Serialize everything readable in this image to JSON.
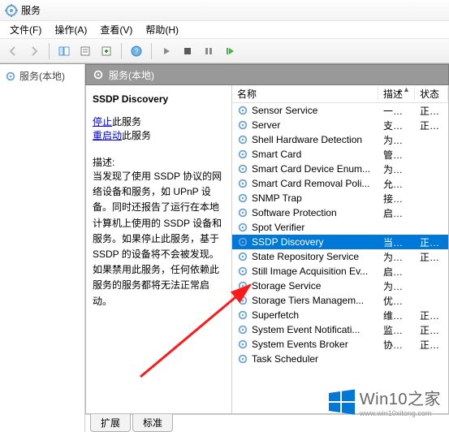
{
  "title": "服务",
  "menus": {
    "file": "文件(F)",
    "action": "操作(A)",
    "view": "查看(V)",
    "help": "帮助(H)"
  },
  "tree": {
    "root": "服务(本地)"
  },
  "panel_header": "服务(本地)",
  "detail": {
    "name_heading": "SSDP Discovery",
    "stop_link": "停止",
    "stop_suffix": "此服务",
    "restart_link": "重启动",
    "restart_suffix": "此服务",
    "desc_label": "描述:",
    "desc_text": "当发现了使用 SSDP 协议的网络设备和服务，如 UPnP 设备。同时还报告了运行在本地计算机上使用的 SSDP 设备和服务。如果停止此服务，基于 SSDP 的设备将不会被发现。如果禁用此服务，任何依赖此服务的服务都将无法正常启动。"
  },
  "columns": {
    "name": "名称",
    "desc": "描述",
    "status": "状态"
  },
  "services": [
    {
      "name": "Sensor Service",
      "desc": "一项...",
      "status": "正在..."
    },
    {
      "name": "Server",
      "desc": "支持...",
      "status": "正在..."
    },
    {
      "name": "Shell Hardware Detection",
      "desc": "为自...",
      "status": ""
    },
    {
      "name": "Smart Card",
      "desc": "管理...",
      "status": ""
    },
    {
      "name": "Smart Card Device Enum...",
      "desc": "为给...",
      "status": ""
    },
    {
      "name": "Smart Card Removal Poli...",
      "desc": "允许...",
      "status": ""
    },
    {
      "name": "SNMP Trap",
      "desc": "接收...",
      "status": ""
    },
    {
      "name": "Software Protection",
      "desc": "启用...",
      "status": ""
    },
    {
      "name": "Spot Verifier",
      "desc": "",
      "status": ""
    },
    {
      "name": "SSDP Discovery",
      "desc": "当发...",
      "status": "正在...",
      "selected": true
    },
    {
      "name": "State Repository Service",
      "desc": "为应...",
      "status": "正在..."
    },
    {
      "name": "Still Image Acquisition Ev...",
      "desc": "启动...",
      "status": ""
    },
    {
      "name": "Storage Service",
      "desc": "为存...",
      "status": ""
    },
    {
      "name": "Storage Tiers Managem...",
      "desc": "优化...",
      "status": ""
    },
    {
      "name": "Superfetch",
      "desc": "维护...",
      "status": "正在..."
    },
    {
      "name": "System Event Notificati...",
      "desc": "监视...",
      "status": "正在..."
    },
    {
      "name": "System Events Broker",
      "desc": "协调...",
      "status": "正在..."
    },
    {
      "name": "Task Scheduler",
      "desc": "",
      "status": ""
    }
  ],
  "tabs": {
    "extended": "扩展",
    "standard": "标准"
  },
  "watermark": "Win10之家",
  "watermark_sub": "www.win10xitong.com"
}
